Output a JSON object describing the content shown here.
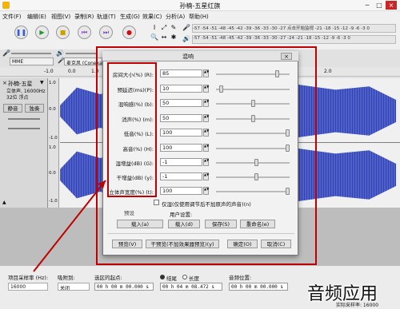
{
  "app": {
    "title": "孙楠-五星红旗"
  },
  "menu": [
    "文件(F)",
    "编辑(E)",
    "视图(V)",
    "录制(R)",
    "轨道(T)",
    "生成(G)",
    "效果(C)",
    "分析(A)",
    "帮助(H)"
  ],
  "toolbar": {
    "ruler1": "-57 -54 -51 -48 -45 -42 -39 -36 -33 -30 -27 点击开始监视 -21 -18 -15 -12 -9 -6 -3 0",
    "ruler2": "-57 -54 -51 -48 -45 -42 -39 -36 -33 -30 -27 -24 -21 -18 -15 -12 -9 -6 -3 0",
    "host": "MME",
    "mic": "麦克风 (Conexant"
  },
  "timeline": {
    "ticks": [
      "-1.0",
      "0.0",
      "1.0",
      "2.0"
    ]
  },
  "track": {
    "name": "孙楠-五星",
    "info": "立体声, 16000Hz\n32位 浮点",
    "mute": "静音",
    "solo": "独奏",
    "scale_top": "1.0",
    "scale_mid_upper": "0.0",
    "scale_neg": "-1.0",
    "scale_top2": "1.0",
    "scale_mid_lower": "0.0",
    "scale_neg2": "-1.0"
  },
  "dialog": {
    "title": "混响",
    "close": "×",
    "params": [
      {
        "label": "房间大小(%) (R):",
        "value": "85",
        "slider": 0.85
      },
      {
        "label": "预延迟(ms)(P):",
        "value": "10",
        "slider": 0.05
      },
      {
        "label": "混响感(%) (b):",
        "value": "50",
        "slider": 0.5
      },
      {
        "label": "消声(%) (m):",
        "value": "50",
        "slider": 0.5
      },
      {
        "label": "低音(%) (L):",
        "value": "100",
        "slider": 1.0
      },
      {
        "label": "高音(%) (H):",
        "value": "100",
        "slider": 1.0
      },
      {
        "label": "湿增益(dB) (G):",
        "value": "-1",
        "slider": 0.55
      },
      {
        "label": "干增益(dB) (y):",
        "value": "-1",
        "slider": 0.55
      },
      {
        "label": "立体声宽度(%) (t):",
        "value": "100",
        "slider": 1.0
      }
    ],
    "wet_only": "仅湿(仅使用调节后不加原声的声音)(n)",
    "preset_label": "预设",
    "user_settings_label": "用户设置:",
    "load_preset": "载入(a)",
    "load_user": "载入(d)",
    "save": "保存(S)",
    "rename": "重命名(e)",
    "preview": "预览(V)",
    "dry_preview": "干预览(不加效果器预览)(y)",
    "ok": "确定(O)",
    "cancel": "取消(C)"
  },
  "bottom": {
    "rate_label": "项目采样率 (Hz):",
    "rate_value": "16000",
    "snap_label": "吸附到:",
    "snap_value": "关闭",
    "sel_start_label": "选区的起点:",
    "sel_start_value": "00 h 00 m 00.000 s",
    "end_label": "结尾",
    "length_label": "长度",
    "sel_end_value": "00 h 04 m 08.472 s",
    "pos_label": "音频位置:",
    "pos_value": "00 h 00 m 00.000 s",
    "status": "实际采样率: 16000"
  },
  "watermark": "音频应用"
}
